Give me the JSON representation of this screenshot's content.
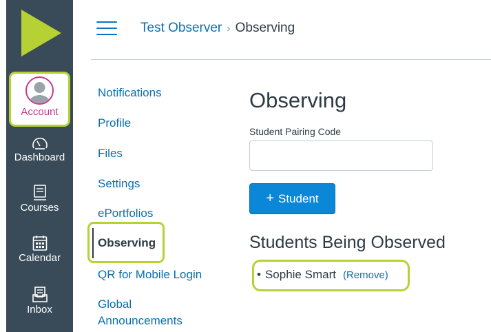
{
  "nav": {
    "account_label": "Account",
    "items": [
      {
        "label": "Dashboard",
        "icon": "dashboard-icon"
      },
      {
        "label": "Courses",
        "icon": "courses-icon"
      },
      {
        "label": "Calendar",
        "icon": "calendar-icon"
      },
      {
        "label": "Inbox",
        "icon": "inbox-icon"
      }
    ]
  },
  "header": {
    "breadcrumb_link": "Test Observer",
    "breadcrumb_separator": "›",
    "breadcrumb_current": "Observing"
  },
  "context_menu": {
    "items": [
      "Notifications",
      "Profile",
      "Files",
      "Settings",
      "ePortfolios",
      "Observing",
      "QR for Mobile Login",
      "Global",
      "Announcements"
    ],
    "active": "Observing"
  },
  "main": {
    "title": "Observing",
    "pairing_label": "Student Pairing Code",
    "pairing_value": "",
    "add_button_plus": "+",
    "add_button_label": "Student",
    "section_title": "Students Being Observed",
    "students": [
      {
        "name": "Sophie Smart",
        "remove_label": "(Remove)"
      }
    ]
  },
  "colors": {
    "nav_bg": "#394b58",
    "logo_green": "#b6d133",
    "highlight": "#b6d133",
    "account_accent": "#c53a8f",
    "link": "#0b6fb0",
    "primary_button": "#0b87d8",
    "text": "#2d3b45"
  }
}
